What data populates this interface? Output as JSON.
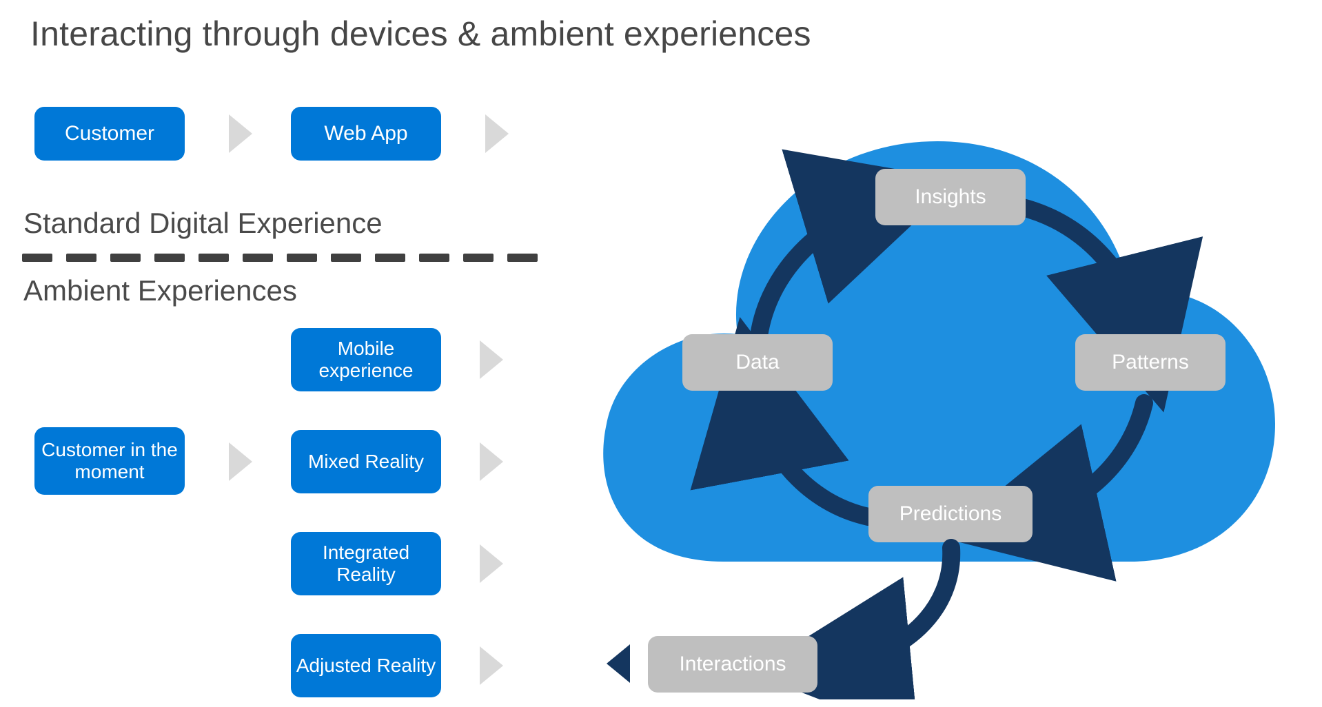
{
  "title": "Interacting through devices & ambient experiences",
  "sections": {
    "standard": "Standard Digital Experience",
    "ambient": "Ambient Experiences"
  },
  "flow_top": {
    "customer": "Customer",
    "webapp": "Web App"
  },
  "ambient_flow": {
    "source": "Customer in the moment",
    "channels": [
      "Mobile experience",
      "Mixed Reality",
      "Integrated Reality",
      "Adjusted Reality"
    ]
  },
  "cloud_cycle": {
    "top": "Insights",
    "right": "Patterns",
    "bottom": "Predictions",
    "left": "Data"
  },
  "cloud_output": "Interactions",
  "colors": {
    "brand_blue": "#0078d7",
    "cloud_blue": "#1e8fe0",
    "node_gray": "#bfbfbf",
    "arrow_navy": "#14365f",
    "chev_gray": "#d9d9d9"
  }
}
